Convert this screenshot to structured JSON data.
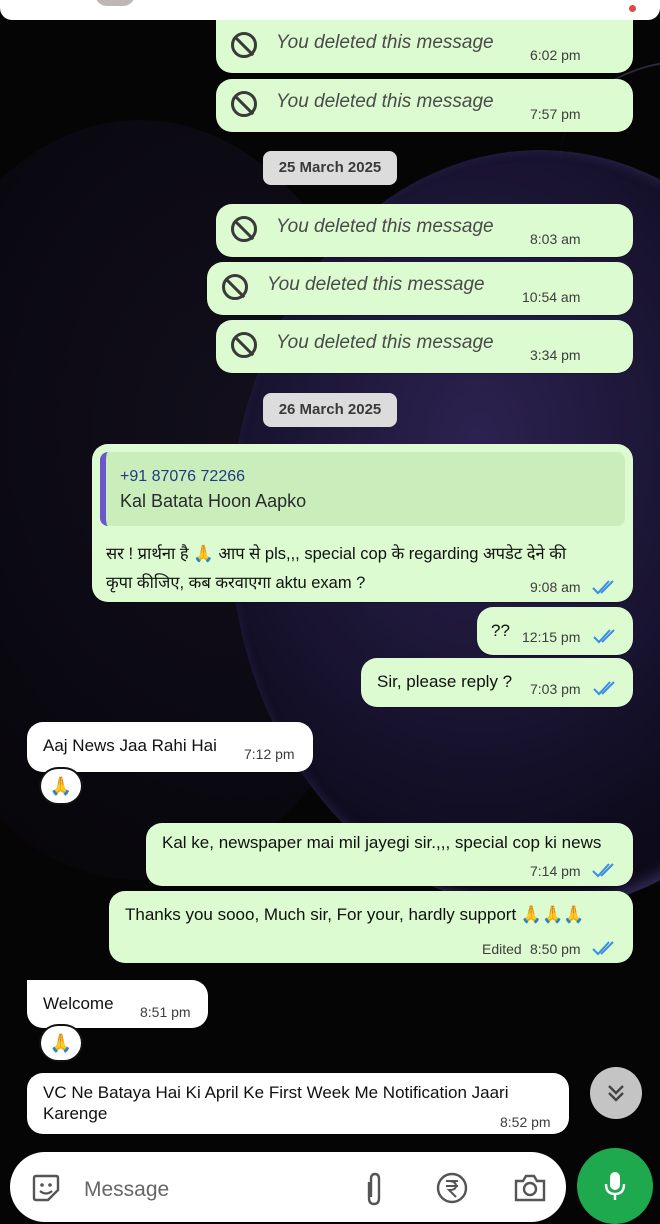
{
  "colors": {
    "outgoing_bubble": "#dcfbd0",
    "incoming_bubble": "#ffffff",
    "read_ticks": "#3a8ee6",
    "send_button": "#1fa94f",
    "quote_bar": "#6c56c9"
  },
  "deleted_text": "You deleted this message",
  "messages": [
    {
      "type": "deleted",
      "time": "6:02 pm"
    },
    {
      "type": "deleted",
      "time": "7:57 pm"
    },
    {
      "type": "date",
      "label": "25 March 2025"
    },
    {
      "type": "deleted",
      "time": "8:03 am"
    },
    {
      "type": "deleted",
      "time": "10:54 am"
    },
    {
      "type": "deleted",
      "time": "3:34 pm"
    },
    {
      "type": "date",
      "label": "26 March 2025"
    },
    {
      "type": "outgoing-reply",
      "quote_name": "+91 87076 72266",
      "quote_text": "Kal Batata Hoon Aapko",
      "text_line1": "सर ! प्रार्थना है 🙏 आप से pls,,, special cop के regarding अपडेट देने की",
      "text_line2": "कृपा कीजिए, कब करवाएगा aktu exam  ?",
      "time": "9:08 am"
    },
    {
      "type": "outgoing",
      "text": "??",
      "time": "12:15 pm"
    },
    {
      "type": "outgoing",
      "text": "Sir, please reply  ?",
      "time": "7:03 pm"
    },
    {
      "type": "incoming",
      "text": "Aaj News Jaa Rahi Hai",
      "time": "7:12 pm",
      "reaction": "🙏"
    },
    {
      "type": "outgoing",
      "text": "Kal ke, newspaper mai mil jayegi sir.,,, special cop ki news",
      "time": "7:14 pm"
    },
    {
      "type": "outgoing",
      "text": "Thanks you sooo, Much sir, For your, hardly support 🙏🙏🙏",
      "edited": "Edited",
      "time": "8:50 pm"
    },
    {
      "type": "incoming",
      "text": "Welcome",
      "time": "8:51 pm",
      "reaction": "🙏"
    },
    {
      "type": "incoming",
      "text_line1": "VC Ne Bataya Hai Ki April Ke First Week Me Notification Jaari",
      "text_line2": "Karenge",
      "time": "8:52 pm"
    }
  ],
  "input": {
    "placeholder": "Message",
    "icons": [
      "sticker-icon",
      "paperclip-icon",
      "rupee-icon",
      "camera-icon",
      "mic-icon"
    ]
  },
  "scroll_down_icon": "double-chevron-down-icon"
}
